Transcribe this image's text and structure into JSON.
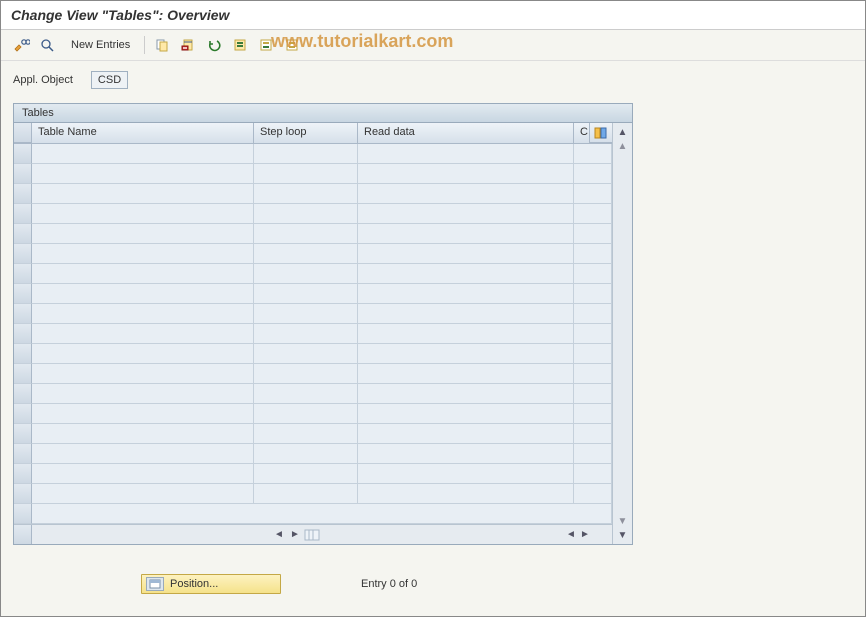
{
  "header": {
    "title": "Change View \"Tables\": Overview"
  },
  "toolbar": {
    "new_entries_label": "New Entries"
  },
  "watermark": "www.tutorialkart.com",
  "fields": {
    "appl_object_label": "Appl. Object",
    "appl_object_value": "CSD"
  },
  "table": {
    "title": "Tables",
    "columns": [
      "Table Name",
      "Step loop",
      "Read data",
      "C"
    ],
    "row_count_empty": 18,
    "last_row_single_cell": true
  },
  "footer": {
    "position_label": "Position...",
    "entry_label": "Entry 0 of 0"
  },
  "icons": {
    "toggle": "toggle-display-change-icon",
    "find": "find-icon",
    "copy": "copy-icon",
    "delete": "delete-icon",
    "undo": "undo-icon",
    "select_all": "select-all-icon",
    "select_block": "select-block-icon",
    "deselect": "deselect-icon",
    "config": "table-settings-icon"
  }
}
